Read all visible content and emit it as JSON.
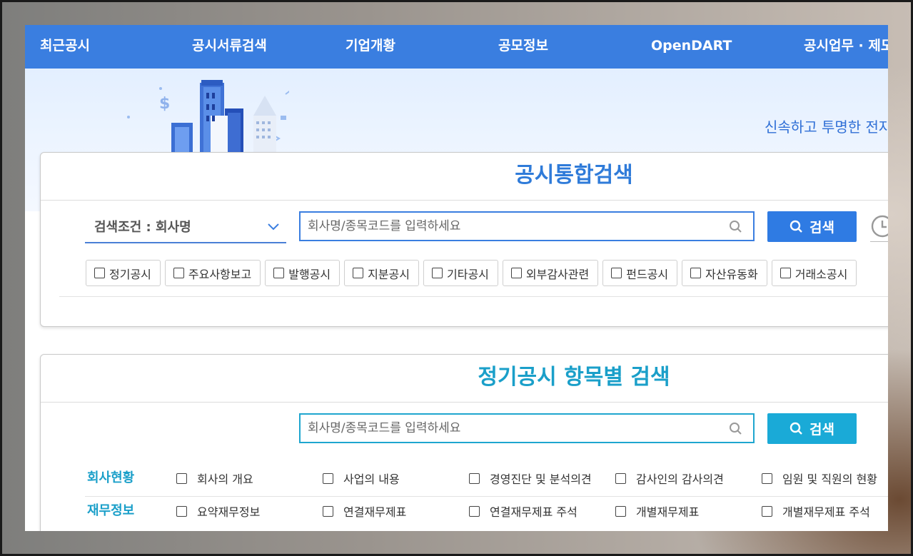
{
  "nav": {
    "items": [
      "최근공시",
      "공시서류검색",
      "기업개황",
      "공모정보",
      "OpenDART",
      "공시업무 · 제도"
    ]
  },
  "hero": {
    "slogan": "신속하고 투명한 전자공시시스템"
  },
  "integrated_search": {
    "title": "공시통합검색",
    "condition_label": "검색조건 : 회사명",
    "placeholder": "회사명/종목코드를 입력하세요",
    "button_label": "검색",
    "categories": [
      "정기공시",
      "주요사항보고",
      "발행공시",
      "지분공시",
      "기타공시",
      "외부감사관련",
      "펀드공시",
      "자산유동화",
      "거래소공시"
    ]
  },
  "item_search": {
    "title": "정기공시 항목별 검색",
    "placeholder": "회사명/종목코드를 입력하세요",
    "button_label": "검색",
    "rows": [
      {
        "heading": "회사현황",
        "items": [
          "회사의 개요",
          "사업의 내용",
          "경영진단 및 분석의견",
          "감사인의 감사의견",
          "임원 및 직원의 현황"
        ]
      },
      {
        "heading": "재무정보",
        "items": [
          "요약재무정보",
          "연결재무제표",
          "연결재무제표 주석",
          "개별재무제표",
          "개별재무제표 주석"
        ]
      }
    ]
  },
  "colors": {
    "nav_blue": "#3a7ee0",
    "title_blue": "#2f7bd9",
    "teal": "#1a9fc9"
  },
  "icons": [
    "search-icon",
    "chevron-down-icon",
    "history-clock-icon",
    "checkbox-icon",
    "city-illustration"
  ]
}
